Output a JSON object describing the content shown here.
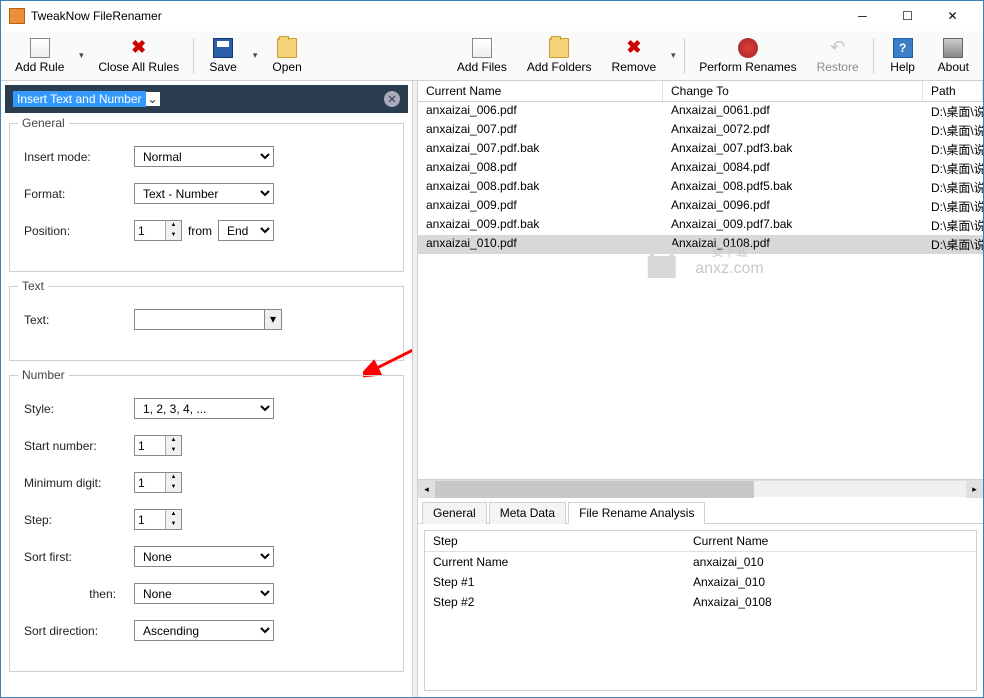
{
  "window": {
    "title": "TweakNow FileRenamer"
  },
  "toolbar": {
    "addRule": "Add Rule",
    "closeAll": "Close All Rules",
    "save": "Save",
    "open": "Open",
    "addFiles": "Add Files",
    "addFolders": "Add Folders",
    "remove": "Remove",
    "perform": "Perform Renames",
    "restore": "Restore",
    "help": "Help",
    "about": "About"
  },
  "rule": {
    "type": "Insert Text and Number",
    "groups": {
      "general": {
        "title": "General",
        "insertModeLabel": "Insert mode:",
        "insertMode": "Normal",
        "formatLabel": "Format:",
        "format": "Text - Number",
        "positionLabel": "Position:",
        "position": "1",
        "fromLabel": "from",
        "from": "End"
      },
      "text": {
        "title": "Text",
        "textLabel": "Text:",
        "text": ""
      },
      "number": {
        "title": "Number",
        "styleLabel": "Style:",
        "style": "1, 2, 3, 4, ...",
        "startLabel": "Start number:",
        "start": "1",
        "mindigitLabel": "Minimum digit:",
        "mindigit": "1",
        "stepLabel": "Step:",
        "step": "1",
        "sortFirstLabel": "Sort first:",
        "sortFirst": "None",
        "thenLabel": "then:",
        "then": "None",
        "sortDirLabel": "Sort direction:",
        "sortDir": "Ascending"
      }
    }
  },
  "fileList": {
    "headers": {
      "name": "Current Name",
      "change": "Change To",
      "path": "Path"
    },
    "rows": [
      {
        "name": "anxaizai_006.pdf",
        "change": "Anxaizai_0061.pdf",
        "path": "D:\\桌面\\说",
        "sel": false
      },
      {
        "name": "anxaizai_007.pdf",
        "change": "Anxaizai_0072.pdf",
        "path": "D:\\桌面\\说",
        "sel": false
      },
      {
        "name": "anxaizai_007.pdf.bak",
        "change": "Anxaizai_007.pdf3.bak",
        "path": "D:\\桌面\\说",
        "sel": false
      },
      {
        "name": "anxaizai_008.pdf",
        "change": "Anxaizai_0084.pdf",
        "path": "D:\\桌面\\说",
        "sel": false
      },
      {
        "name": "anxaizai_008.pdf.bak",
        "change": "Anxaizai_008.pdf5.bak",
        "path": "D:\\桌面\\说",
        "sel": false
      },
      {
        "name": "anxaizai_009.pdf",
        "change": "Anxaizai_0096.pdf",
        "path": "D:\\桌面\\说",
        "sel": false
      },
      {
        "name": "anxaizai_009.pdf.bak",
        "change": "Anxaizai_009.pdf7.bak",
        "path": "D:\\桌面\\说",
        "sel": false
      },
      {
        "name": "anxaizai_010.pdf",
        "change": "Anxaizai_0108.pdf",
        "path": "D:\\桌面\\说",
        "sel": true
      }
    ]
  },
  "watermark": {
    "text": "安下载",
    "sub": "anxz.com"
  },
  "tabs": {
    "general": "General",
    "meta": "Meta Data",
    "analysis": "File Rename Analysis"
  },
  "analysis": {
    "headers": {
      "step": "Step",
      "name": "Current Name"
    },
    "rows": [
      {
        "step": "Current Name",
        "name": "anxaizai_010"
      },
      {
        "step": "Step #1",
        "name": "Anxaizai_010"
      },
      {
        "step": "Step #2",
        "name": "Anxaizai_0108"
      }
    ]
  }
}
